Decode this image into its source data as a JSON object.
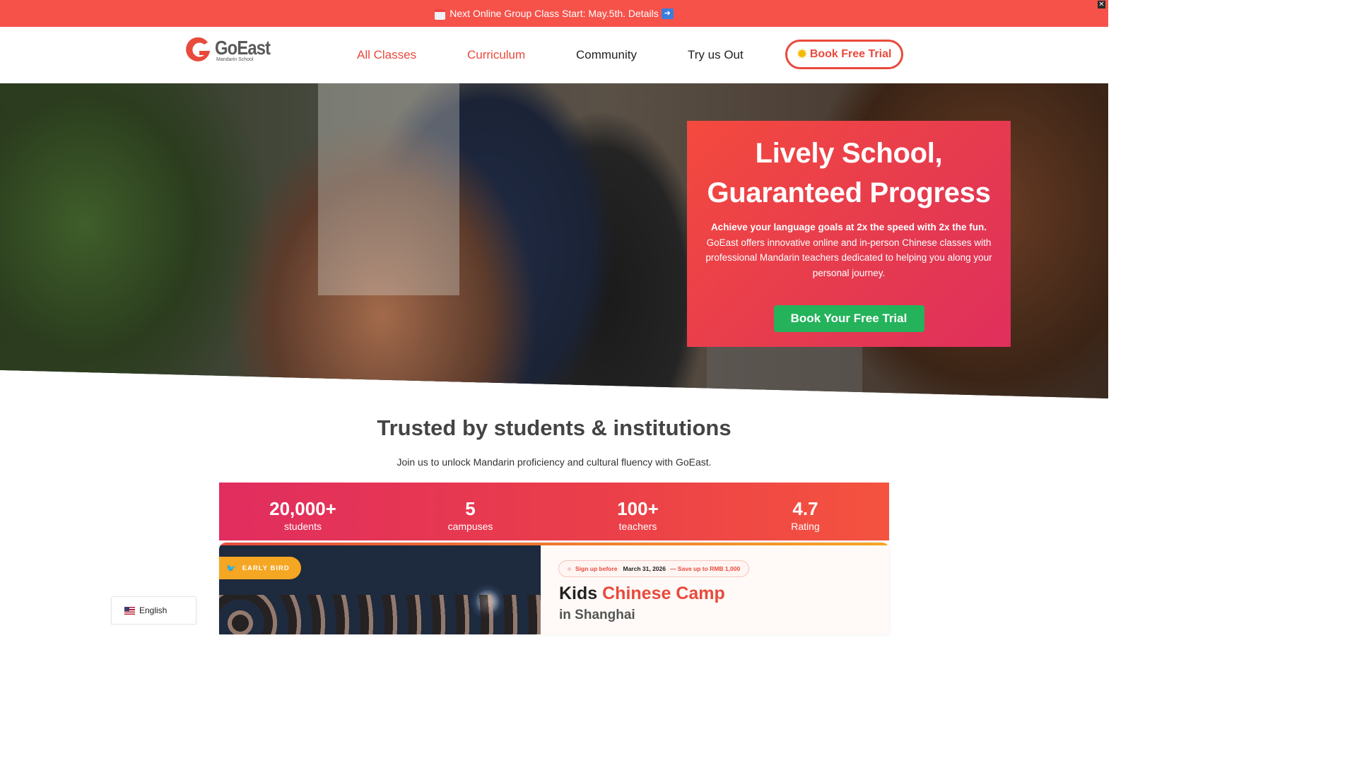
{
  "announcement": {
    "text": "Next Online Group Class Start: May.5th. Details",
    "calendar_icon": "calendar-icon",
    "arrow_icon": "arrow-right-icon",
    "close_icon": "close-icon"
  },
  "header": {
    "logo_name": "GoEast",
    "logo_sub": "Mandarin School",
    "nav": [
      {
        "label": "All Classes"
      },
      {
        "label": "Curriculum"
      },
      {
        "label": "Community"
      },
      {
        "label": "Try us Out"
      }
    ],
    "cta_label": "Book Free Trial",
    "cta_icon": "sun-icon"
  },
  "hero": {
    "title_line1": "Lively School,",
    "title_line2": "Guaranteed Progress",
    "desc_bold": "Achieve your language goals at 2x the speed with 2x the fun.",
    "desc_rest": " GoEast offers innovative online and in-person Chinese classes with professional Mandarin teachers dedicated to helping you along your personal journey.",
    "button_label": "Book Your Free Trial"
  },
  "trusted": {
    "title": "Trusted by students & institutions",
    "subtitle": "Join us to unlock Mandarin proficiency and cultural fluency with GoEast.",
    "stats": [
      {
        "value": "20,000+",
        "label": "students"
      },
      {
        "value": "5",
        "label": "campuses"
      },
      {
        "value": "100+",
        "label": "teachers"
      },
      {
        "value": "4.7",
        "label": "Rating"
      }
    ]
  },
  "camp": {
    "badge": "EARLY BIRD",
    "pill_a": "Sign up before",
    "pill_b": "March 31, 2026",
    "pill_c": "— Save up to RMB 1,000",
    "title_plain": "Kids ",
    "title_red": "Chinese Camp",
    "subtitle": "in Shanghai"
  },
  "language": {
    "label": "English",
    "flag_icon": "us-flag-icon"
  },
  "colors": {
    "brand_red": "#e84a3c",
    "announce_bg": "#f6524a",
    "green": "#24b35b",
    "orange": "#f5a623"
  }
}
